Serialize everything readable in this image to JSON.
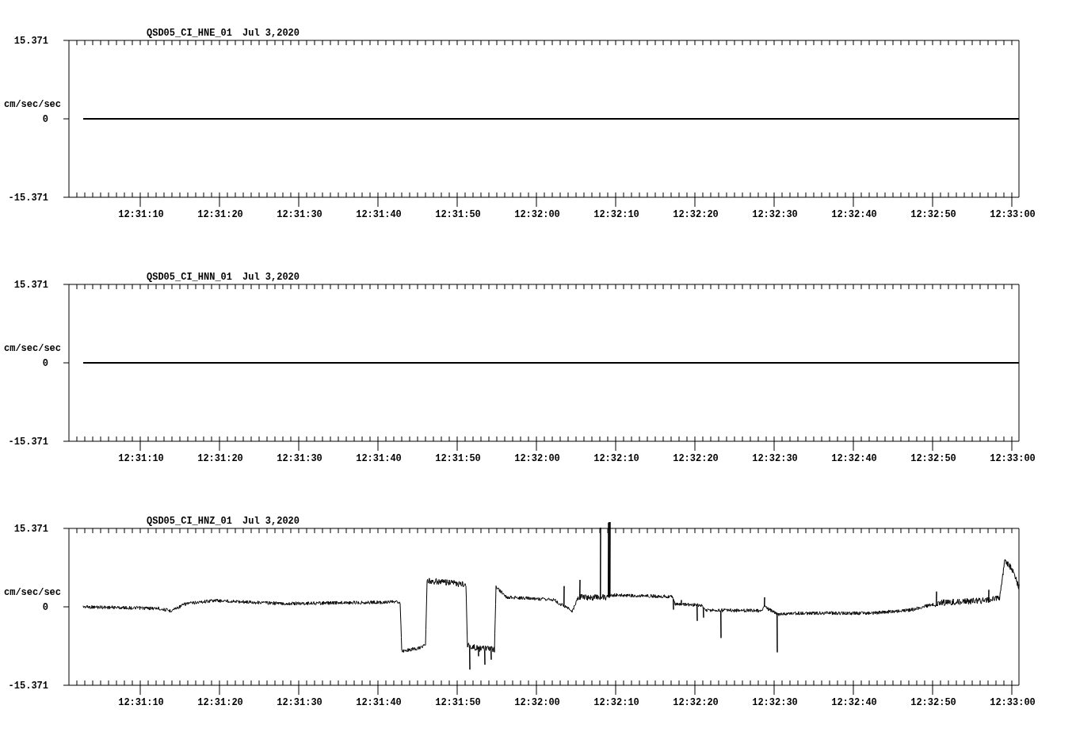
{
  "panels": [
    {
      "station": "QSD05_CI_HNE_01",
      "date": "Jul 3,2020",
      "ylabel": "cm/sec/sec",
      "yticks": [
        "15.371",
        "0",
        "-15.371"
      ],
      "xticks": [
        "12:31:10",
        "12:31:20",
        "12:31:30",
        "12:31:40",
        "12:31:50",
        "12:32:00",
        "12:32:10",
        "12:32:20",
        "12:32:30",
        "12:32:40",
        "12:32:50",
        "12:33:00"
      ],
      "trace": {
        "kind": "flat"
      }
    },
    {
      "station": "QSD05_CI_HNN_01",
      "date": "Jul 3,2020",
      "ylabel": "cm/sec/sec",
      "yticks": [
        "15.371",
        "0",
        "-15.371"
      ],
      "xticks": [
        "12:31:10",
        "12:31:20",
        "12:31:30",
        "12:31:40",
        "12:31:50",
        "12:32:00",
        "12:32:10",
        "12:32:20",
        "12:32:30",
        "12:32:40",
        "12:32:50",
        "12:33:00"
      ],
      "trace": {
        "kind": "flat"
      }
    },
    {
      "station": "QSD05_CI_HNZ_01",
      "date": "Jul 3,2020",
      "ylabel": "cm/sec/sec",
      "yticks": [
        "15.371",
        "0",
        "-15.371"
      ],
      "xticks": [
        "12:31:10",
        "12:31:20",
        "12:31:30",
        "12:31:40",
        "12:31:50",
        "12:32:00",
        "12:32:10",
        "12:32:20",
        "12:32:30",
        "12:32:40",
        "12:32:50",
        "12:33:00"
      ],
      "trace": {
        "kind": "waveform"
      }
    }
  ]
}
